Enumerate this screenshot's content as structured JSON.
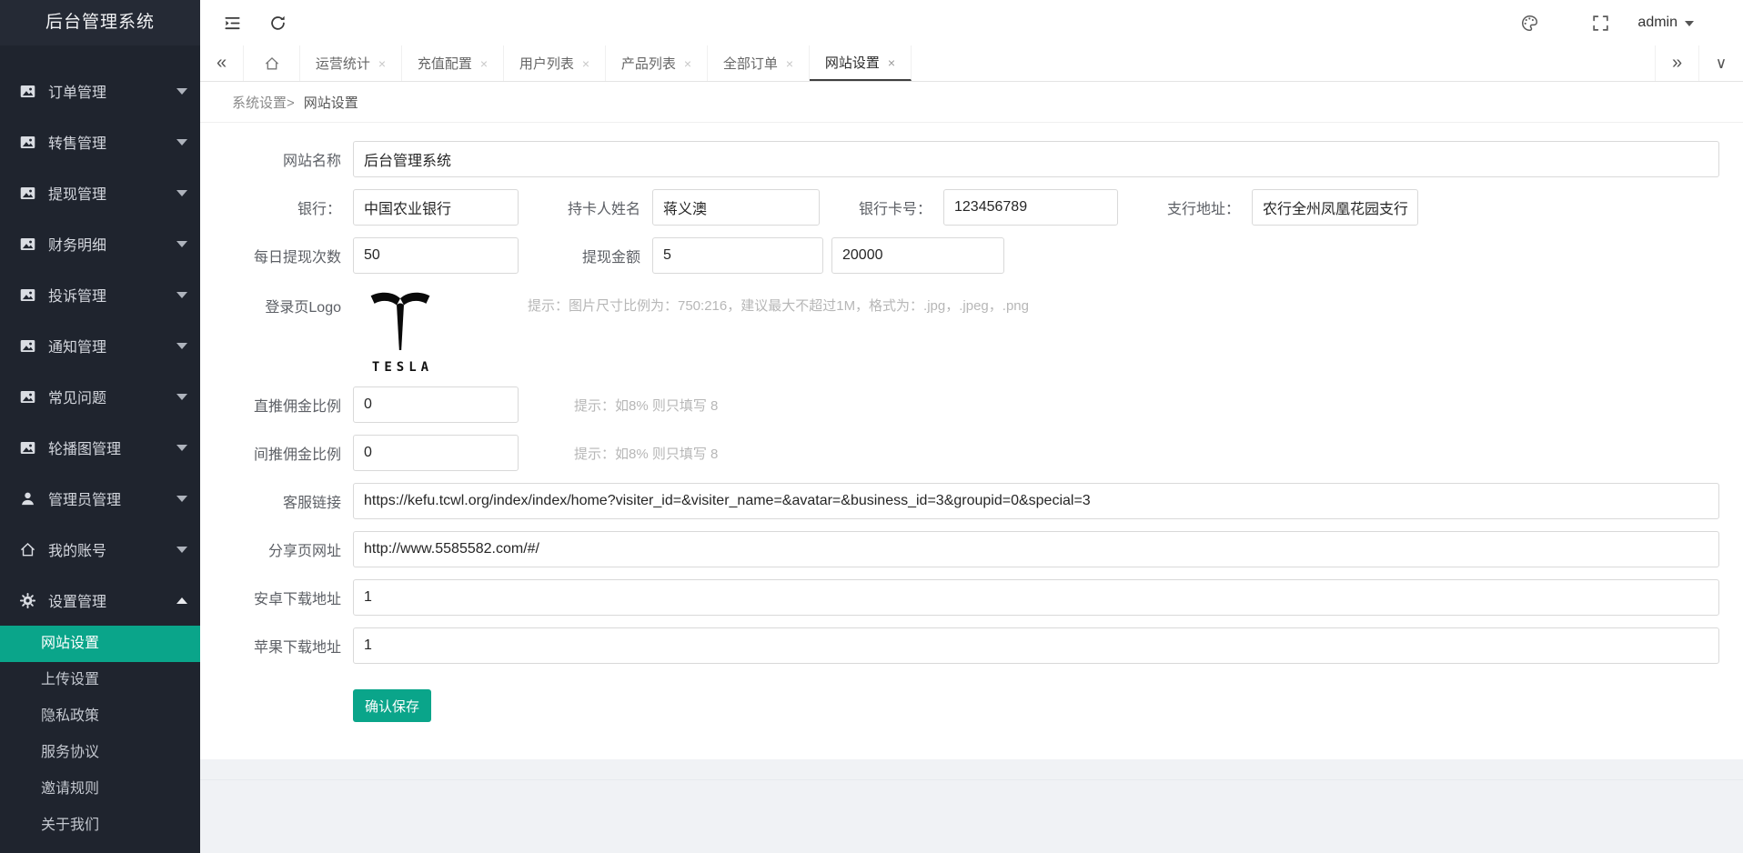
{
  "app": {
    "title": "后台管理系统"
  },
  "sidebar": {
    "items": [
      {
        "label": "订单管理"
      },
      {
        "label": "转售管理"
      },
      {
        "label": "提现管理"
      },
      {
        "label": "财务明细"
      },
      {
        "label": "投诉管理"
      },
      {
        "label": "通知管理"
      },
      {
        "label": "常见问题"
      },
      {
        "label": "轮播图管理"
      },
      {
        "label": "管理员管理"
      },
      {
        "label": "我的账号"
      },
      {
        "label": "设置管理"
      }
    ],
    "submenu": [
      {
        "label": "网站设置"
      },
      {
        "label": "上传设置"
      },
      {
        "label": "隐私政策"
      },
      {
        "label": "服务协议"
      },
      {
        "label": "邀请规则"
      },
      {
        "label": "关于我们"
      }
    ]
  },
  "header": {
    "username": "admin"
  },
  "icons": {
    "close": "×",
    "collapse_left": "«",
    "scroll_right": "»",
    "tabs_dropdown": "∨"
  },
  "tabs": [
    "运营统计",
    "充值配置",
    "用户列表",
    "产品列表",
    "全部订单",
    "网站设置"
  ],
  "breadcrumb": {
    "parent": "系统设置>",
    "current": "网站设置"
  },
  "form": {
    "site_name": {
      "label": "网站名称",
      "value": "后台管理系统"
    },
    "bank": {
      "label": "银行：",
      "value": "中国农业银行"
    },
    "cardholder": {
      "label": "持卡人姓名",
      "value": "蒋义澳"
    },
    "card_no": {
      "label": "银行卡号：",
      "value": "123456789"
    },
    "branch": {
      "label": "支行地址：",
      "value": "农行全州凤凰花园支行"
    },
    "daily_times": {
      "label": "每日提现次数",
      "value": "50"
    },
    "withdraw": {
      "label": "提现金额",
      "min": "5",
      "max": "20000"
    },
    "logo": {
      "label": "登录页Logo",
      "brand": "TESLA",
      "hint": "提示：图片尺寸比例为：750:216，建议最大不超过1M，格式为：.jpg，.jpeg，.png"
    },
    "direct_rate": {
      "label": "直推佣金比例",
      "value": "0",
      "hint": "提示：如8% 则只填写 8"
    },
    "indirect_rate": {
      "label": "间推佣金比例",
      "value": "0",
      "hint": "提示：如8% 则只填写 8"
    },
    "service_link": {
      "label": "客服链接",
      "value": "https://kefu.tcwl.org/index/index/home?visiter_id=&visiter_name=&avatar=&business_id=3&groupid=0&special=3"
    },
    "share_url": {
      "label": "分享页网址",
      "value": "http://www.5585582.com/#/"
    },
    "android_url": {
      "label": "安卓下载地址",
      "value": "1"
    },
    "ios_url": {
      "label": "苹果下载地址",
      "value": "1"
    },
    "save": "确认保存"
  },
  "colors": {
    "accent": "#0aa58a",
    "sidebar_bg": "#1f242e"
  }
}
